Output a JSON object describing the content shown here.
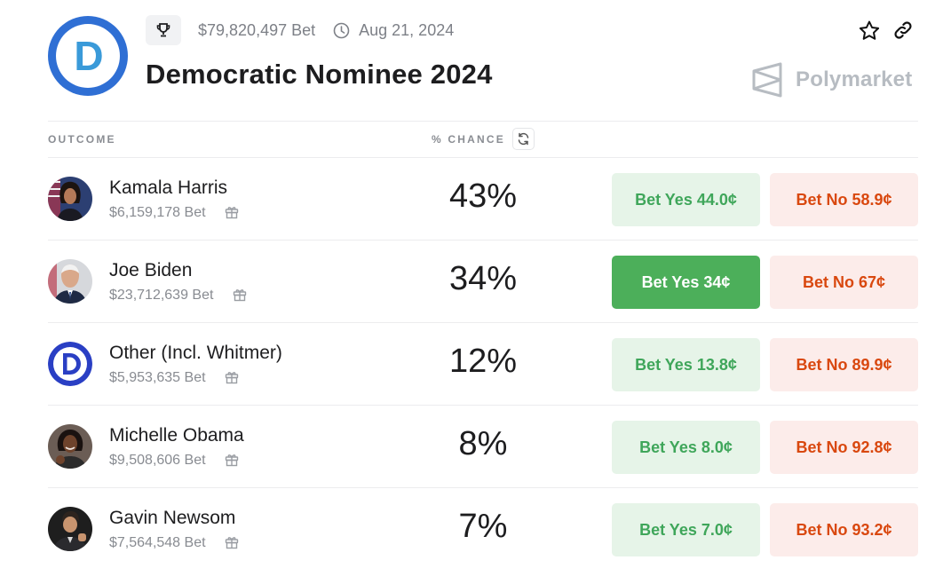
{
  "header": {
    "volume": "$79,820,497 Bet",
    "date": "Aug 21, 2024",
    "title": "Democratic Nominee 2024",
    "brand": "Polymarket",
    "logo_letter": "D"
  },
  "table": {
    "col_outcome": "OUTCOME",
    "col_chance": "% CHANCE",
    "rows": [
      {
        "name": "Kamala Harris",
        "volume": "$6,159,178 Bet",
        "chance": "43%",
        "yes": "Bet Yes 44.0¢",
        "no": "Bet No 58.9¢"
      },
      {
        "name": "Joe Biden",
        "volume": "$23,712,639 Bet",
        "chance": "34%",
        "yes": "Bet Yes 34¢",
        "no": "Bet No 67¢"
      },
      {
        "name": "Other (Incl. Whitmer)",
        "volume": "$5,953,635 Bet",
        "chance": "12%",
        "yes": "Bet Yes 13.8¢",
        "no": "Bet No 89.9¢"
      },
      {
        "name": "Michelle Obama",
        "volume": "$9,508,606 Bet",
        "chance": "8%",
        "yes": "Bet Yes 8.0¢",
        "no": "Bet No 92.8¢"
      },
      {
        "name": "Gavin Newsom",
        "volume": "$7,564,548 Bet",
        "chance": "7%",
        "yes": "Bet Yes 7.0¢",
        "no": "Bet No 93.2¢"
      }
    ]
  },
  "colors": {
    "yes_bg": "#e6f4e8",
    "yes_text": "#3fa65a",
    "yes_active_bg": "#4caf5a",
    "no_bg": "#fcecea",
    "no_text": "#d9480f",
    "logo_blue": "#2f6fd4"
  }
}
